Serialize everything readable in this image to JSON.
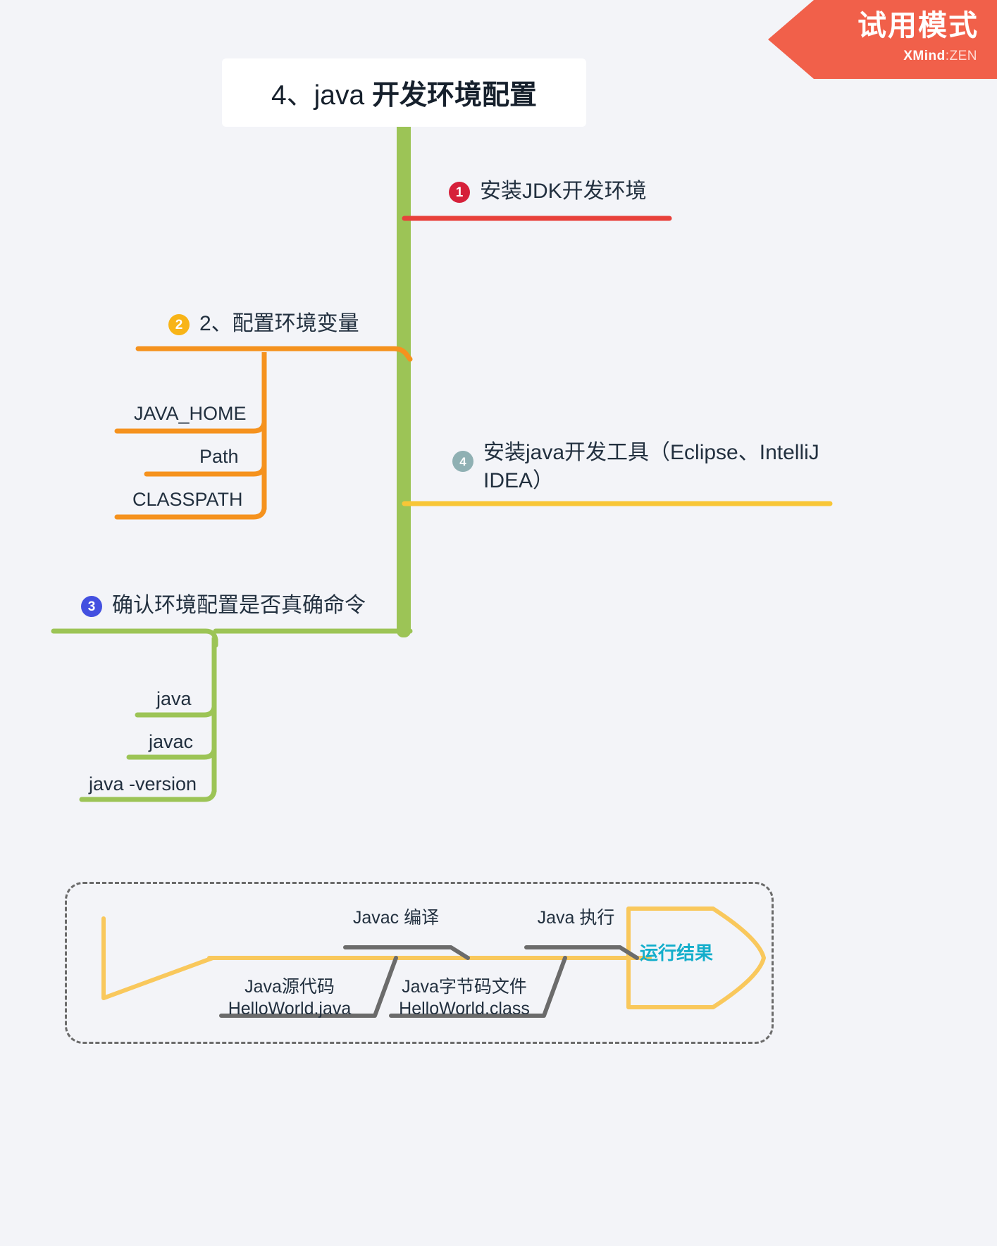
{
  "badge": {
    "title": "试用模式",
    "brand_bold": "XMind",
    "brand_light": ":ZEN",
    "color": "#f1604a"
  },
  "central_topic": {
    "prefix": "4、java ",
    "emphasis": "开发环境配置",
    "full": "4、java 开发环境配置"
  },
  "branches": [
    {
      "marker": "1",
      "marker_color": "#d6203a",
      "label": "安装JDK开发环境",
      "line_color": "#e8413b",
      "children": []
    },
    {
      "marker": "2",
      "marker_color": "#f8b417",
      "label": "2、配置环境变量",
      "line_color": "#f5921e",
      "children": [
        {
          "label": "JAVA_HOME"
        },
        {
          "label": "Path"
        },
        {
          "label": "CLASSPATH"
        }
      ]
    },
    {
      "marker": "3",
      "marker_color": "#4350e0",
      "label": "确认环境配置是否真确命令",
      "line_color": "#9cc456",
      "children": [
        {
          "label": "java"
        },
        {
          "label": "javac"
        },
        {
          "label": "java -version"
        }
      ]
    },
    {
      "marker": "4",
      "marker_color": "#8fb0b3",
      "label": "安装java开发工具（Eclipse、IntelliJ IDEA）",
      "line_color": "#f8c637",
      "children": []
    }
  ],
  "fishbone": {
    "spine_color": "#f9c85c",
    "bone_color": "#6b6b6b",
    "result": "运行结果",
    "result_color": "#14aecb",
    "top_bones": [
      {
        "label": "Javac 编译"
      },
      {
        "label": "Java 执行"
      }
    ],
    "bottom_bones": [
      {
        "label": "Java源代码\nHelloWorld.java"
      },
      {
        "label": "Java字节码文件\nHelloWorld.class"
      }
    ]
  },
  "theme": {
    "background": "#f3f4f8",
    "trunk_color": "#9cc456",
    "text_color": "#22303f"
  }
}
